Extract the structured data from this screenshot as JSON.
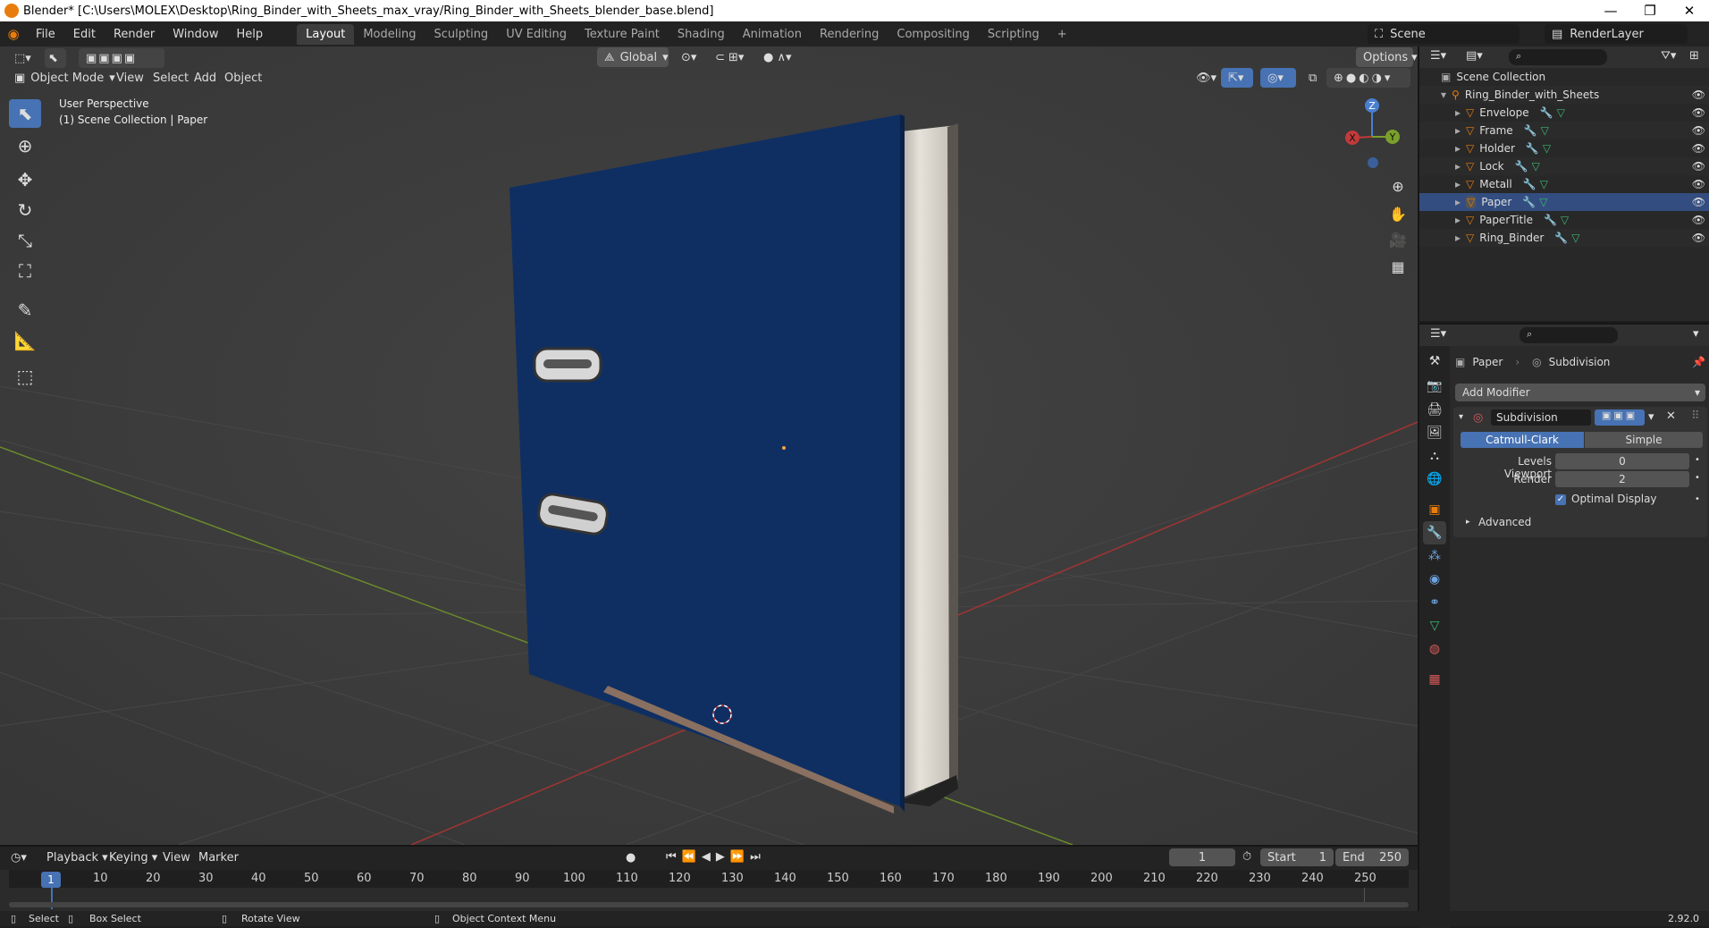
{
  "window": {
    "title": "Blender* [C:\\Users\\MOLEX\\Desktop\\Ring_Binder_with_Sheets_max_vray/Ring_Binder_with_Sheets_blender_base.blend]",
    "minimize": "—",
    "restore": "❐",
    "close": "✕"
  },
  "menu": [
    "File",
    "Edit",
    "Render",
    "Window",
    "Help"
  ],
  "workspaces": [
    "Layout",
    "Modeling",
    "Sculpting",
    "UV Editing",
    "Texture Paint",
    "Shading",
    "Animation",
    "Rendering",
    "Compositing",
    "Scripting"
  ],
  "workspace_add": "+",
  "scene": {
    "name": "Scene",
    "render_layer": "RenderLayer"
  },
  "viewport": {
    "mode": "Object Mode",
    "header_menus": [
      "View",
      "Select",
      "Add",
      "Object"
    ],
    "orientation": "Global",
    "options": "Options",
    "overlay_line1": "User Perspective",
    "overlay_line2": "(1) Scene Collection | Paper",
    "gizmo": {
      "z": "Z",
      "y": "Y",
      "x": "X"
    }
  },
  "outliner": {
    "root": "Scene Collection",
    "collection": "Ring_Binder_with_Sheets",
    "items": [
      "Envelope",
      "Frame",
      "Holder",
      "Lock",
      "Metall",
      "Paper",
      "PaperTitle",
      "Ring_Binder"
    ]
  },
  "properties": {
    "object_name": "Paper",
    "modifier_crumb": "Subdivision",
    "add_modifier": "Add Modifier",
    "modifier_name": "Subdivision",
    "type_catmull": "Catmull-Clark",
    "type_simple": "Simple",
    "levels_viewport_label": "Levels Viewport",
    "levels_viewport_value": "0",
    "render_label": "Render",
    "render_value": "2",
    "optimal_display": "Optimal Display",
    "advanced": "Advanced"
  },
  "timeline": {
    "menus": [
      "Playback",
      "Keying",
      "View",
      "Marker"
    ],
    "current_frame": "1",
    "start_label": "Start",
    "start_value": "1",
    "end_label": "End",
    "end_value": "250",
    "ticks": [
      "1",
      "10",
      "20",
      "30",
      "40",
      "50",
      "60",
      "70",
      "80",
      "90",
      "100",
      "110",
      "120",
      "130",
      "140",
      "150",
      "160",
      "170",
      "180",
      "190",
      "200",
      "210",
      "220",
      "230",
      "240",
      "250"
    ]
  },
  "status": {
    "select": "Select",
    "box_select": "Box Select",
    "rotate_view": "Rotate View",
    "context_menu": "Object Context Menu",
    "version": "2.92.0"
  },
  "colors": {
    "accent": "#4772b3",
    "orange": "#e87d0d",
    "binder_blue": "#0f2f63",
    "axis_x": "#c23a3a",
    "axis_y": "#7aa02a"
  }
}
